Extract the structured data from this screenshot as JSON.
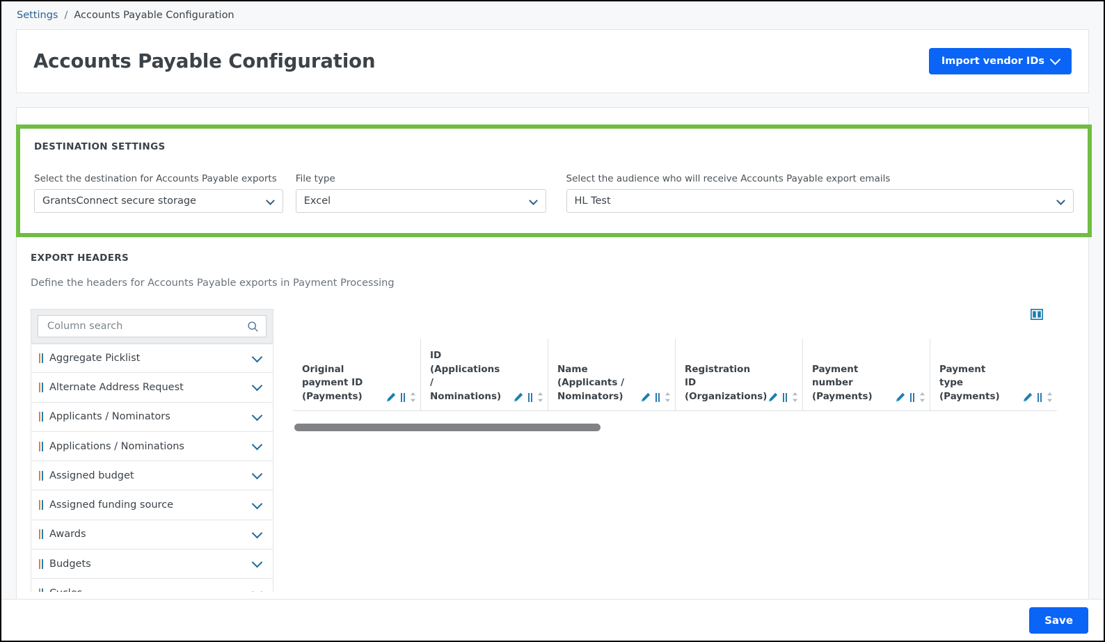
{
  "breadcrumb": {
    "root": "Settings",
    "separator": "/",
    "current": "Accounts Payable Configuration"
  },
  "header": {
    "title": "Accounts Payable Configuration",
    "import_button": "Import vendor IDs",
    "import_button_icon": "chevron-down-icon"
  },
  "destination_settings": {
    "section_title": "DESTINATION SETTINGS",
    "highlight_color": "#6fbe44",
    "destination": {
      "label": "Select the destination for Accounts Payable exports",
      "value": "GrantsConnect secure storage"
    },
    "file_type": {
      "label": "File type",
      "value": "Excel"
    },
    "audience": {
      "label": "Select the audience who will receive Accounts Payable export emails",
      "value": "HL Test"
    }
  },
  "export_headers": {
    "section_title": "EXPORT HEADERS",
    "description": "Define the headers for Accounts Payable exports in Payment Processing",
    "search_placeholder": "Column search",
    "search_value": "",
    "search_icon": "search-icon",
    "columns_icon": "columns-layout-icon",
    "list": [
      {
        "label": "Aggregate Picklist"
      },
      {
        "label": "Alternate Address Request"
      },
      {
        "label": "Applicants / Nominators"
      },
      {
        "label": "Applications / Nominations"
      },
      {
        "label": "Assigned budget"
      },
      {
        "label": "Assigned funding source"
      },
      {
        "label": "Awards"
      },
      {
        "label": "Budgets"
      },
      {
        "label": "Cycles"
      }
    ],
    "table_columns": [
      {
        "label": "Original payment ID (Payments)"
      },
      {
        "label": "ID (Applications / Nominations)"
      },
      {
        "label": "Name (Applicants / Nominators)"
      },
      {
        "label": "Registration ID (Organizations)"
      },
      {
        "label": "Payment number (Payments)"
      },
      {
        "label": "Payment type (Payments)"
      }
    ]
  },
  "footer": {
    "save_label": "Save"
  },
  "colors": {
    "primary_blue": "#0a64f5",
    "highlight_green": "#6fbe44",
    "link_blue": "#2a6496",
    "icon_blue": "#2b7cad"
  }
}
